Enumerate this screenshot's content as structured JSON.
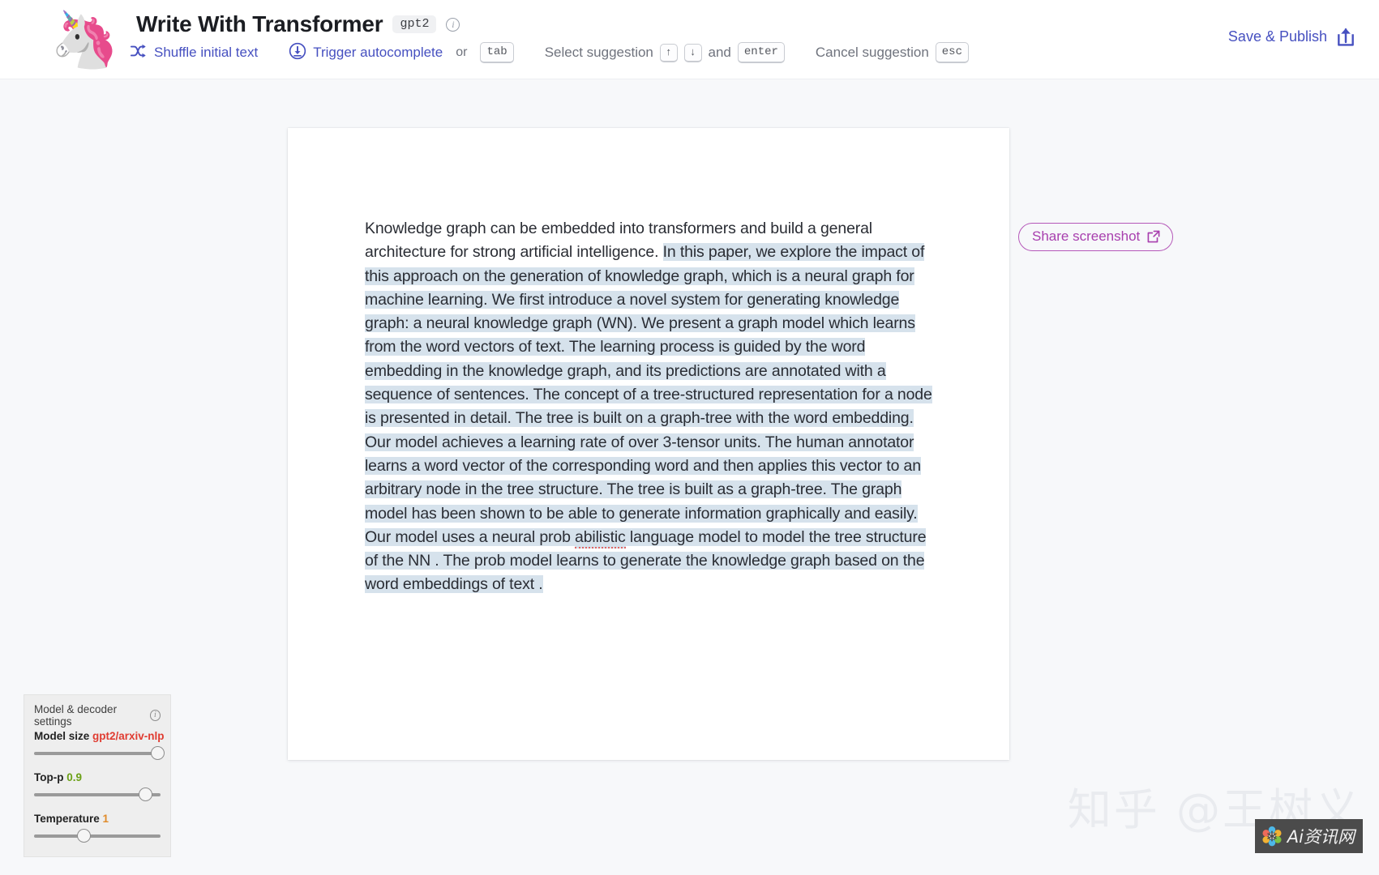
{
  "header": {
    "logo_emoji": "🦄",
    "title": "Write With Transformer",
    "model_badge": "gpt2",
    "info_glyph": "i",
    "shortcuts": [
      {
        "icon": "shuffle-icon",
        "label": "Shuffle initial text",
        "keys": []
      },
      {
        "icon": "download-circle-icon",
        "label": "Trigger autocomplete",
        "or": "or",
        "keys": [
          "tab"
        ]
      },
      {
        "icon": "",
        "label": "Select suggestion",
        "keys": [
          "↑",
          "↓"
        ],
        "and": "and",
        "keys2": [
          "enter"
        ]
      },
      {
        "icon": "",
        "label": "Cancel suggestion",
        "keys": [
          "esc"
        ]
      }
    ],
    "shuffle_label": "Shuffle initial text",
    "autocomplete_label": "Trigger autocomplete",
    "or_label": "or",
    "tab_key": "tab",
    "select_label": "Select suggestion",
    "up_key": "↑",
    "down_key": "↓",
    "and_label": "and",
    "enter_key": "enter",
    "cancel_label": "Cancel suggestion",
    "esc_key": "esc",
    "save_publish_label": "Save & Publish"
  },
  "editor": {
    "prompt_text": "Knowledge graph can be embedded into transformers and build a general architecture for strong artificial intelligence. ",
    "generated_text_part1": " In this paper, we explore the impact of this approach on the generation of knowledge graph, which is a neural graph for machine learning. We first introduce a novel system for generating knowledge graph: a neural knowledge graph (WN).  We present a graph model which learns from the word vectors of text. The learning process is guided by the word embedding in the knowledge graph, and its predictions are annotated with  a sequence of sentences. The concept of a tree-structured representation for a node is presented in detail. The tree is built on a graph-tree with the word embedding. Our model achieves a learning rate of over 3-tensor units. The human annotator learns a word vector of the corresponding  word and then applies this vector to an arbitrary node in the tree structure. The tree is built as a graph-tree. The graph model has been shown to be able to generate information graphically and easily. Our model uses a neural prob ",
    "misspelled_word": "abilistic",
    "generated_text_part2": " language model to model the tree structure of the NN . The prob model learns  to generate the knowledge graph based on the word embeddings of text ."
  },
  "share": {
    "label": "Share screenshot",
    "icon": "external-link-icon",
    "accent_color": "#a83fae"
  },
  "settings": {
    "panel_title": "Model & decoder settings",
    "info_glyph": "i",
    "controls": [
      {
        "label": "Model size",
        "value": "gpt2/arxiv-nlp",
        "value_color": "#e03c31",
        "thumb_percent": 94
      },
      {
        "label": "Top-p",
        "value": "0.9",
        "value_color": "#6aa015",
        "thumb_percent": 85
      },
      {
        "label": "Temperature",
        "value": "1",
        "value_color": "#e08b2a",
        "thumb_percent": 37
      }
    ],
    "model_size_label": "Model size",
    "model_size_value": "gpt2/arxiv-nlp",
    "topp_label": "Top-p",
    "topp_value": "0.9",
    "temperature_label": "Temperature",
    "temperature_value": "1"
  },
  "watermark": {
    "text": "知乎 @王树义",
    "badge_text": "Ai资讯网"
  }
}
